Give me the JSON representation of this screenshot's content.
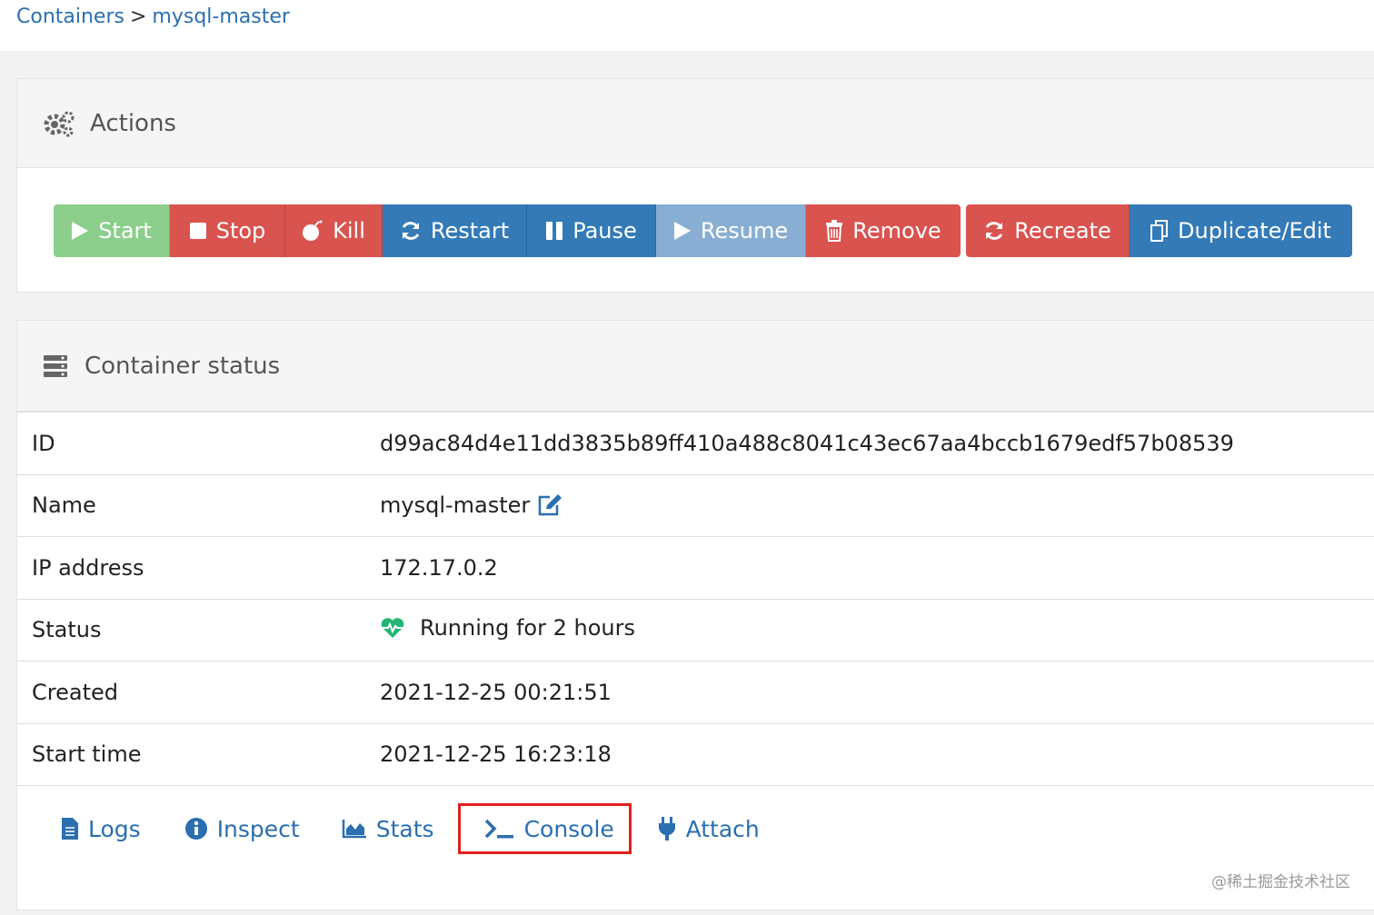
{
  "breadcrumb": {
    "root": "Containers",
    "separator": ">",
    "current": "mysql-master"
  },
  "actions": {
    "title": "Actions",
    "icon": "cogs-icon",
    "buttons": {
      "start": "Start",
      "stop": "Stop",
      "kill": "Kill",
      "restart": "Restart",
      "pause": "Pause",
      "resume": "Resume",
      "remove": "Remove",
      "recreate": "Recreate",
      "duplicate_edit": "Duplicate/Edit"
    }
  },
  "status": {
    "title": "Container status",
    "icon": "server-icon",
    "rows": {
      "id": {
        "key": "ID",
        "value": "d99ac84d4e11dd3835b89ff410a488c8041c43ec67aa4bccb1679edf57b08539"
      },
      "name": {
        "key": "Name",
        "value": "mysql-master"
      },
      "ip": {
        "key": "IP address",
        "value": "172.17.0.2"
      },
      "state": {
        "key": "Status",
        "value": "Running for 2 hours"
      },
      "created": {
        "key": "Created",
        "value": "2021-12-25 00:21:51"
      },
      "start_time": {
        "key": "Start time",
        "value": "2021-12-25 16:23:18"
      }
    }
  },
  "tabs": {
    "logs": "Logs",
    "inspect": "Inspect",
    "stats": "Stats",
    "console": "Console",
    "attach": "Attach"
  },
  "watermark": "@稀土掘金技术社区",
  "colors": {
    "link": "#2a6fb0",
    "success_disabled": "#8cce8c",
    "danger": "#d9534f",
    "primary": "#337ab7",
    "primary_disabled": "#89aed3",
    "running_heart": "#22b573",
    "highlight_box": "#e02020"
  }
}
